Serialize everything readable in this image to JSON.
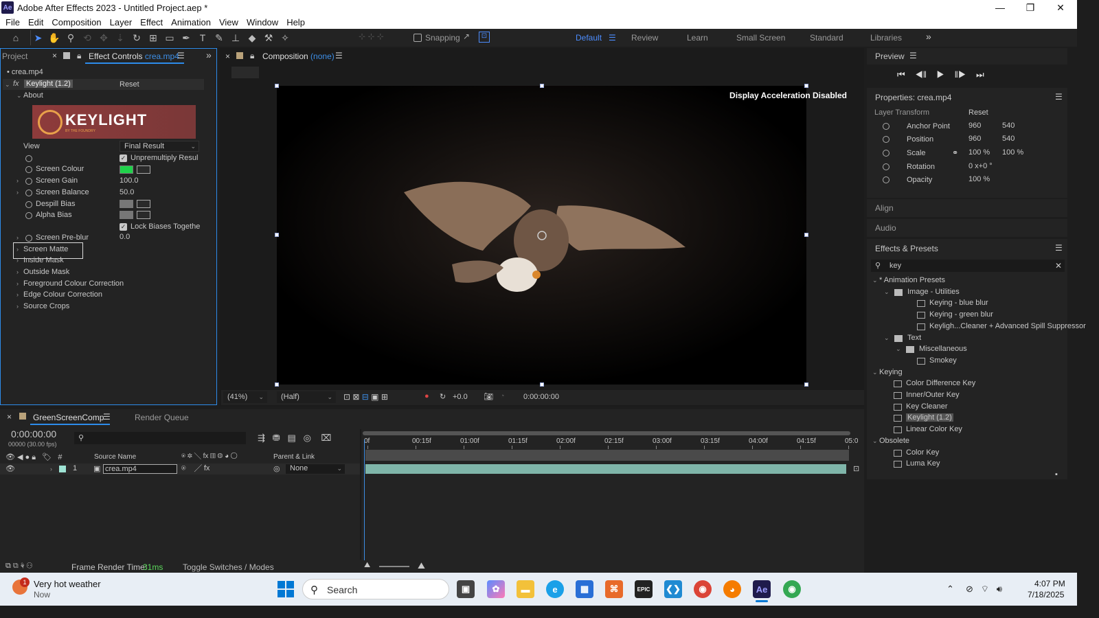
{
  "app": {
    "icon": "Ae",
    "title": "Adobe After Effects 2023 - Untitled Project.aep *"
  },
  "menu": [
    "File",
    "Edit",
    "Composition",
    "Layer",
    "Effect",
    "Animation",
    "View",
    "Window",
    "Help"
  ],
  "toolbar": {
    "snapping": "Snapping"
  },
  "workspaces": [
    "Default",
    "Review",
    "Learn",
    "Small Screen",
    "Standard",
    "Libraries"
  ],
  "left": {
    "tab_project": "Project",
    "tab_effect_controls": "Effect Controls",
    "effect_file": "crea.mp4",
    "layer_name": "• crea.mp4",
    "effect_name": "Keylight (1.2)",
    "reset": "Reset",
    "about": "About",
    "logo": "KEYLIGHT",
    "logo_sub": "BY THE FOUNDRY",
    "view_label": "View",
    "view_value": "Final Result",
    "unpremultiply": "Unpremultiply Resul",
    "screen_colour": "Screen Colour",
    "screen_gain": "Screen Gain",
    "screen_gain_val": "100.0",
    "screen_balance": "Screen Balance",
    "screen_balance_val": "50.0",
    "despill_bias": "Despill Bias",
    "alpha_bias": "Alpha Bias",
    "lock_biases": "Lock Biases Togethe",
    "screen_preblur": "Screen Pre-blur",
    "screen_preblur_val": "0.0",
    "screen_matte": "Screen Matte",
    "inside_mask": "Inside Mask",
    "outside_mask": "Outside Mask",
    "fg_colour": "Foreground Colour Correction",
    "edge_colour": "Edge Colour Correction",
    "source_crops": "Source Crops",
    "screen_colour_hex": "#1fd24a"
  },
  "comp": {
    "tab": "Composition",
    "tab_none": "(none)",
    "overlay": "Display Acceleration Disabled",
    "zoom": "(41%)",
    "res": "(Half)",
    "exposure": "+0.0",
    "timecode": "0:00:00:00"
  },
  "right": {
    "preview": "Preview",
    "properties": "Properties: crea.mp4",
    "layer_transform": "Layer Transform",
    "reset": "Reset",
    "anchor": "Anchor Point",
    "anchor_x": "960",
    "anchor_y": "540",
    "position": "Position",
    "pos_x": "960",
    "pos_y": "540",
    "scale": "Scale",
    "scale_x": "100 %",
    "scale_y": "100 %",
    "rotation": "Rotation",
    "rotation_val": "0 x+0 °",
    "opacity": "Opacity",
    "opacity_val": "100 %",
    "align": "Align",
    "audio": "Audio",
    "effects_presets": "Effects & Presets",
    "search": "key",
    "tree": [
      {
        "label": "* Animation Presets",
        "indent": 0,
        "type": "chev"
      },
      {
        "label": "Image - Utilities",
        "indent": 1,
        "type": "folder"
      },
      {
        "label": "Keying - blue blur",
        "indent": 3,
        "type": "preset"
      },
      {
        "label": "Keying - green blur",
        "indent": 3,
        "type": "preset"
      },
      {
        "label": "Keyligh...Cleaner + Advanced Spill Suppressor",
        "indent": 3,
        "type": "preset"
      },
      {
        "label": "Text",
        "indent": 1,
        "type": "folder"
      },
      {
        "label": "Miscellaneous",
        "indent": 2,
        "type": "folder"
      },
      {
        "label": "Smokey",
        "indent": 3,
        "type": "preset"
      },
      {
        "label": "Keying",
        "indent": 0,
        "type": "chev"
      },
      {
        "label": "Color Difference Key",
        "indent": 1,
        "type": "effect"
      },
      {
        "label": "Inner/Outer Key",
        "indent": 1,
        "type": "effect"
      },
      {
        "label": "Key Cleaner",
        "indent": 1,
        "type": "effect"
      },
      {
        "label": "Keylight (1.2)",
        "indent": 1,
        "type": "effect",
        "selected": true
      },
      {
        "label": "Linear Color Key",
        "indent": 1,
        "type": "effect"
      },
      {
        "label": "Obsolete",
        "indent": 0,
        "type": "chev"
      },
      {
        "label": "Color Key",
        "indent": 1,
        "type": "effect"
      },
      {
        "label": "Luma Key",
        "indent": 1,
        "type": "effect"
      }
    ]
  },
  "timeline": {
    "comp_tab": "GreenScreenComp",
    "render_queue": "Render Queue",
    "timecode": "0:00:00:00",
    "fps": "00000 (30.00 fps)",
    "col_source": "Source Name",
    "col_parent": "Parent & Link",
    "layer_num": "1",
    "layer_name": "crea.mp4",
    "parent": "None",
    "ruler": [
      "0f",
      "00:15f",
      "01:00f",
      "01:15f",
      "02:00f",
      "02:15f",
      "03:00f",
      "03:15f",
      "04:00f",
      "04:15f",
      "05:0"
    ],
    "frame_render": "Frame Render Time:",
    "frame_render_val": "31ms",
    "toggle": "Toggle Switches / Modes"
  },
  "taskbar": {
    "weather_title": "Very hot weather",
    "weather_sub": "Now",
    "badge": "1",
    "search": "Search",
    "time": "4:07 PM",
    "date": "7/18/2025"
  }
}
